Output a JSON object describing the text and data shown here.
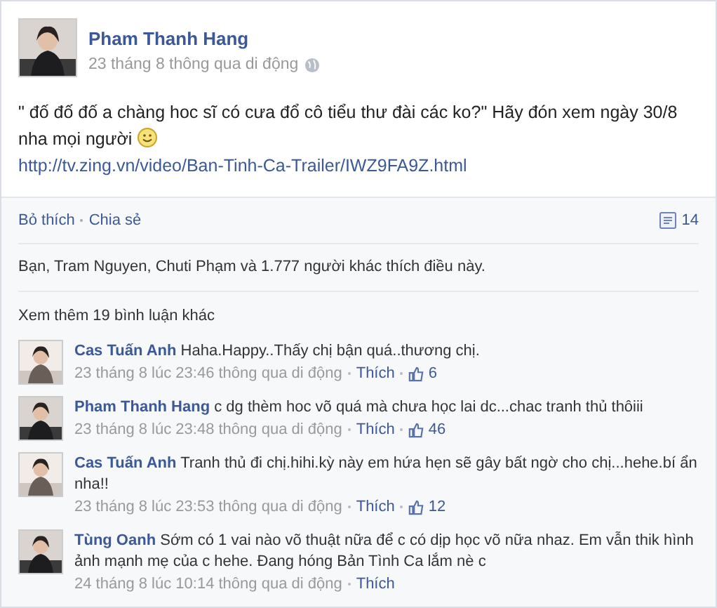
{
  "post": {
    "author": "Pham Thanh Hang",
    "meta": "23 tháng 8 thông qua di động",
    "text": "\" đố đố đố a chàng hoc sĩ có cưa đổ cô tiểu thư đài các ko?\" Hãy đón xem ngày 30/8 nha mọi người",
    "link": "http://tv.zing.vn/video/Ban-Tinh-Ca-Trailer/IWZ9FA9Z.html"
  },
  "actions": [
    "Bỏ thích",
    "Chia sẻ"
  ],
  "comment_count": "14",
  "likes_text": "Bạn, Tram Nguyen, Chuti Phạm và 1.777 người khác thích điều này.",
  "more_comments": "Xem thêm 19 bình luận khác",
  "comments": [
    {
      "author": "Cas Tuấn Anh",
      "text": "Haha.Happy..Thấy chị bận quá..thương chị.",
      "time": "23 tháng 8 lúc 23:46 thông qua di động",
      "like": "Thích",
      "likes": "6"
    },
    {
      "author": "Pham Thanh Hang",
      "text": "c dg thèm hoc võ quá mà chưa học lai dc...chac tranh thủ thôiii",
      "time": "23 tháng 8 lúc 23:48 thông qua di động",
      "like": "Thích",
      "likes": "46"
    },
    {
      "author": "Cas Tuấn Anh",
      "text": "Tranh thủ đi chị.hihi.kỳ này em hứa hẹn sẽ gây bất ngờ cho chị...hehe.bí ẩn nha!!",
      "time": "23 tháng 8 lúc 23:53 thông qua di động",
      "like": "Thích",
      "likes": "12"
    },
    {
      "author": "Tùng Oanh",
      "text": "Sớm có 1 vai nào võ thuật nữa để c có dịp học võ nữa nhaz. Em vẫn thik hình ảnh mạnh mẹ của c hehe. Đang hóng Bản Tình Ca lắm nè c",
      "time": "24 tháng 8 lúc 10:14 thông qua di động",
      "like": "Thích"
    }
  ]
}
